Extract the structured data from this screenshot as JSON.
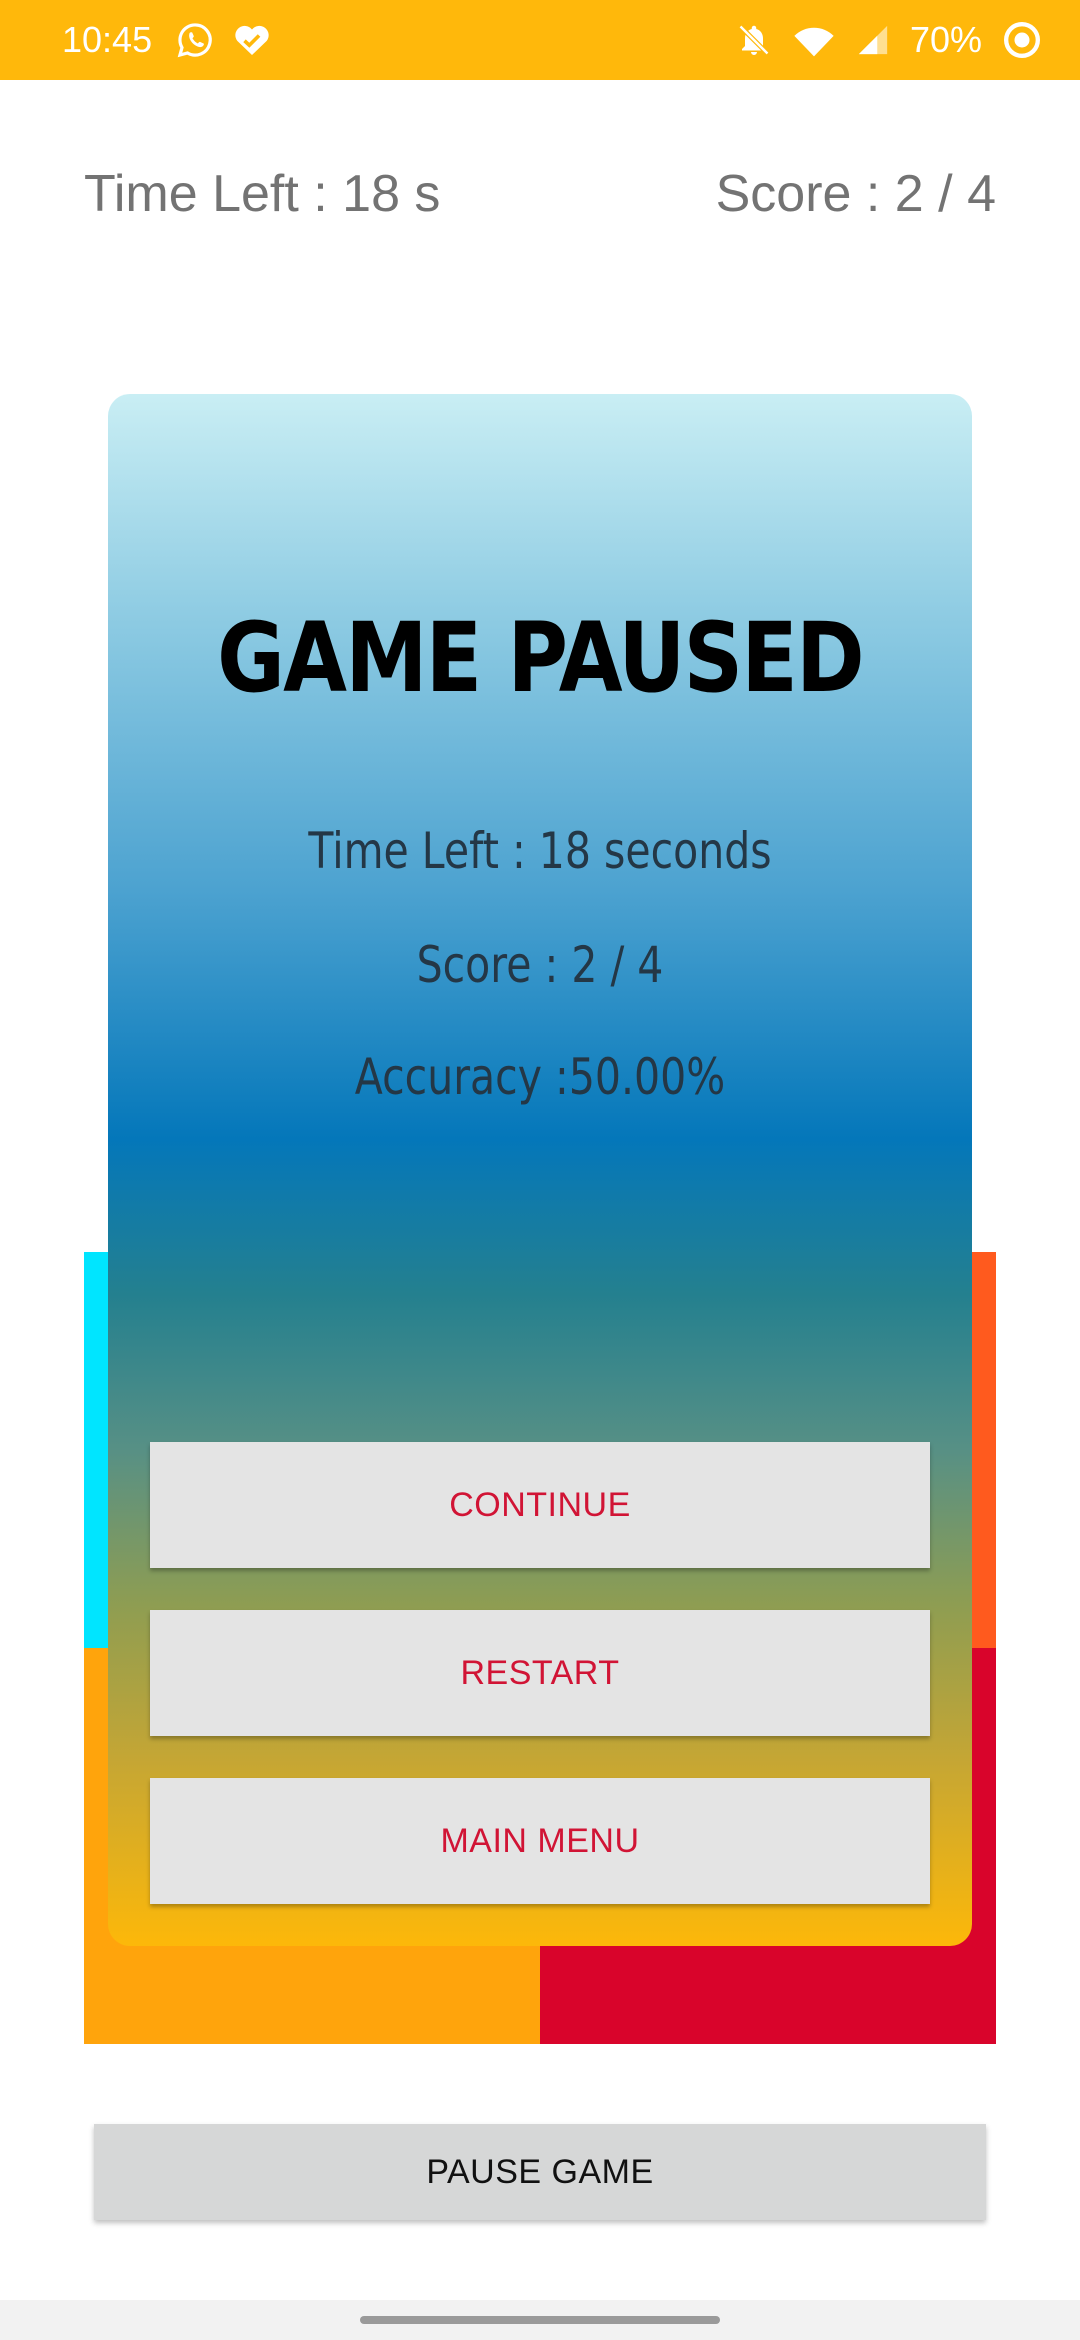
{
  "status_bar": {
    "time": "10:45",
    "battery": "70%",
    "icons": [
      "whatsapp-icon",
      "heart-check-icon",
      "bell-off-icon",
      "wifi-icon",
      "signal-icon",
      "sync-icon"
    ],
    "color": "#FFB80B"
  },
  "game": {
    "time_left": "Time Left : 18 s",
    "score": "Score : 2 / 4",
    "quadrant_colors": [
      "#00E5FF",
      "#FF5A1E",
      "#FFA40C",
      "#D9042B"
    ]
  },
  "dialog": {
    "title": "GAME PAUSED",
    "time_left": "Time Left : 18 seconds",
    "score": "Score : 2 / 4",
    "accuracy": "Accuracy :50.00%",
    "continue_label": "CONTINUE",
    "restart_label": "RESTART",
    "main_menu_label": "MAIN MENU",
    "button_text_color": "#D11435"
  },
  "pause_button": {
    "label": "PAUSE GAME"
  }
}
